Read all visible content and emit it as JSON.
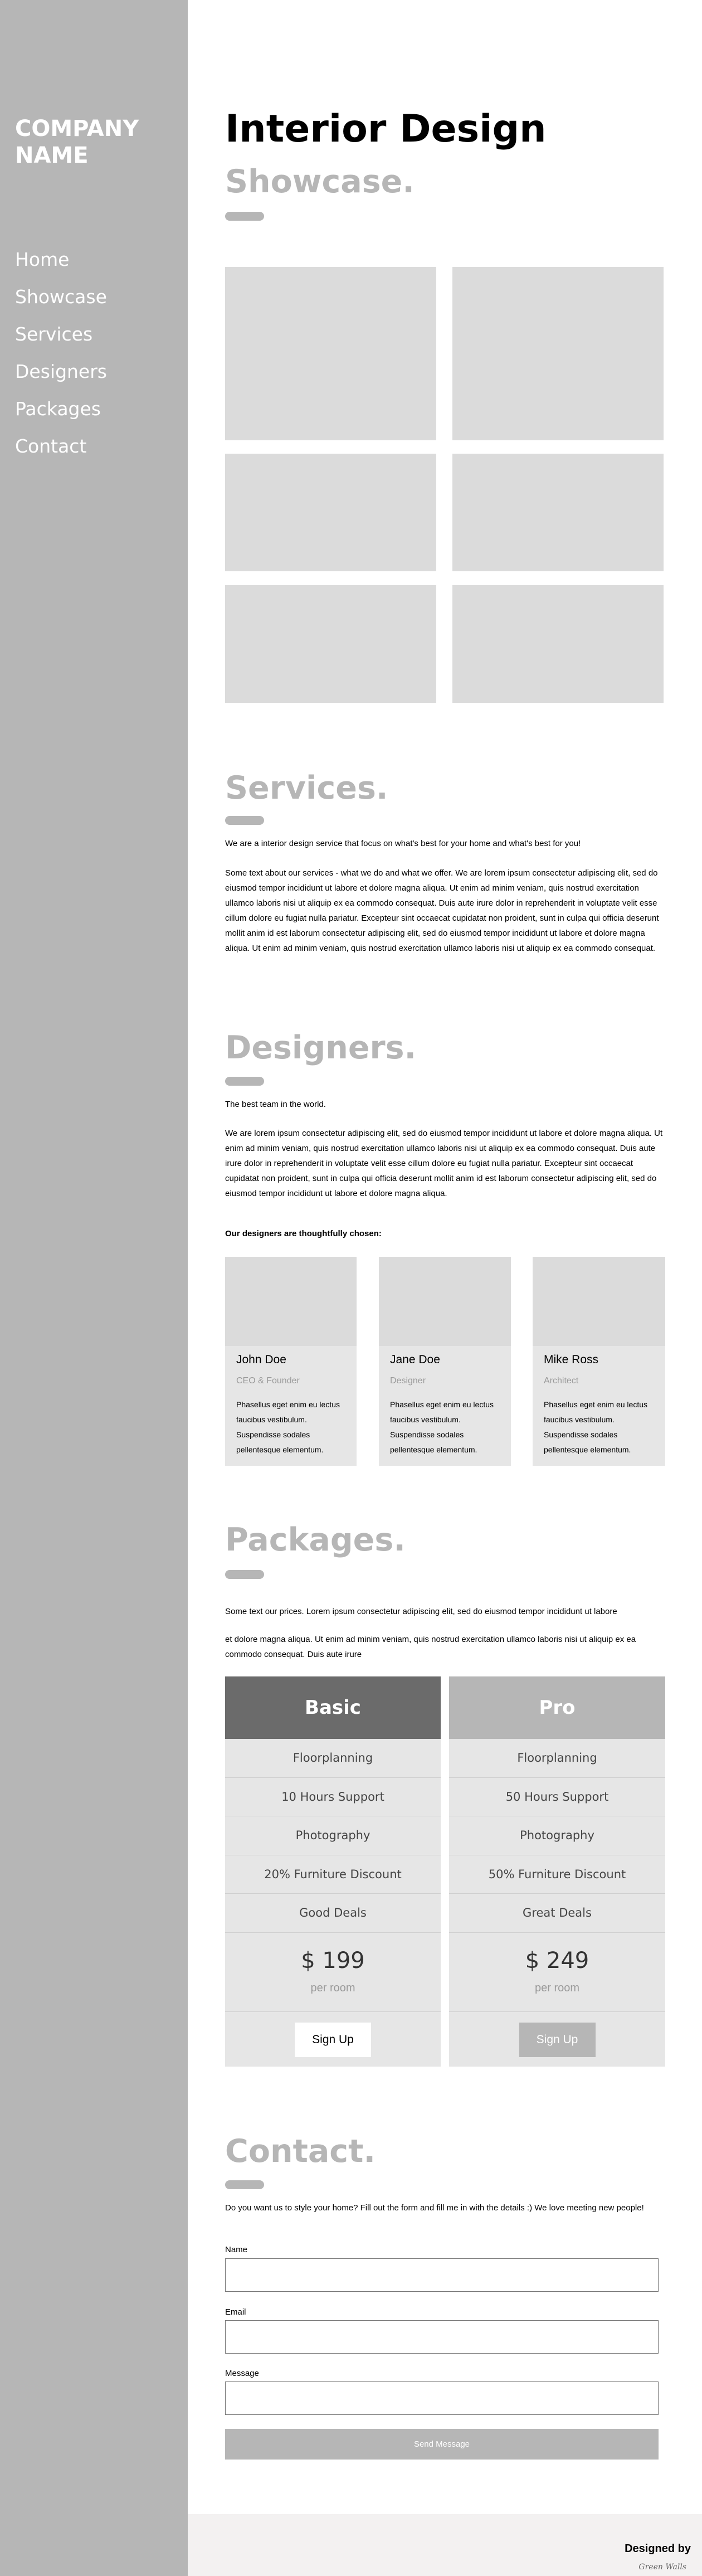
{
  "sidebar": {
    "company": "COMPANY NAME",
    "nav": [
      "Home",
      "Showcase",
      "Services",
      "Designers",
      "Packages",
      "Contact"
    ]
  },
  "hero": {
    "title": "Interior Design",
    "subtitle": "Showcase."
  },
  "services": {
    "heading": "Services.",
    "intro": "We are a interior design service that focus on what's best for your home and what's best for you!",
    "body": "Some text about our services - what we do and what we offer. We are lorem ipsum consectetur adipiscing elit, sed do eiusmod tempor incididunt ut labore et dolore magna aliqua. Ut enim ad minim veniam, quis nostrud exercitation ullamco laboris nisi ut aliquip ex ea commodo consequat. Duis aute irure dolor in reprehenderit in voluptate velit esse cillum dolore eu fugiat nulla pariatur. Excepteur sint occaecat cupidatat non proident, sunt in culpa qui officia deserunt mollit anim id est laborum consectetur adipiscing elit, sed do eiusmod tempor incididunt ut labore et dolore magna aliqua. Ut enim ad minim veniam, quis nostrud exercitation ullamco laboris nisi ut aliquip ex ea commodo consequat."
  },
  "designers": {
    "heading": "Designers.",
    "intro": "The best team in the world.",
    "body": "We are lorem ipsum consectetur adipiscing elit, sed do eiusmod tempor incididunt ut labore et dolore magna aliqua. Ut enim ad minim veniam, quis nostrud exercitation ullamco laboris nisi ut aliquip ex ea commodo consequat. Duis aute irure dolor in reprehenderit in voluptate velit esse cillum dolore eu fugiat nulla pariatur. Excepteur sint occaecat cupidatat non proident, sunt in culpa qui officia deserunt mollit anim id est laborum consectetur adipiscing elit, sed do eiusmod tempor incididunt ut labore et dolore magna aliqua.",
    "chosen": "Our designers are thoughtfully chosen:",
    "people": [
      {
        "name": "John Doe",
        "role": "CEO & Founder",
        "desc": "Phasellus eget enim eu lectus faucibus vestibulum. Suspendisse sodales pellentesque elementum."
      },
      {
        "name": "Jane Doe",
        "role": "Designer",
        "desc": "Phasellus eget enim eu lectus faucibus vestibulum. Suspendisse sodales pellentesque elementum."
      },
      {
        "name": "Mike Ross",
        "role": "Architect",
        "desc": "Phasellus eget enim eu lectus faucibus vestibulum. Suspendisse sodales pellentesque elementum."
      }
    ]
  },
  "packages": {
    "heading": "Packages.",
    "intro": "Some text our prices. Lorem ipsum consectetur adipiscing elit, sed do eiusmod tempor incididunt ut labore",
    "body": "et dolore magna aliqua. Ut enim ad minim veniam, quis nostrud exercitation ullamco laboris nisi ut aliquip ex ea commodo consequat. Duis aute irure",
    "plans": [
      {
        "name": "Basic",
        "head_color": "#6b6b6b",
        "features": [
          "Floorplanning",
          "10 Hours Support",
          "Photography",
          "20% Furniture Discount",
          "Good Deals"
        ],
        "price": "$ 199",
        "per": "per room",
        "button": "Sign Up",
        "btn_bg": "#ffffff",
        "btn_fg": "#000000"
      },
      {
        "name": "Pro",
        "head_color": "#b6b6b6",
        "features": [
          "Floorplanning",
          "50 Hours Support",
          "Photography",
          "50% Furniture Discount",
          "Great Deals"
        ],
        "price": "$ 249",
        "per": "per room",
        "button": "Sign Up",
        "btn_bg": "#b6b6b6",
        "btn_fg": "#ffffff"
      }
    ]
  },
  "contact": {
    "heading": "Contact.",
    "intro": "Do you want us to style your home? Fill out the form and fill me in with the details :) We love meeting new people!",
    "name_label": "Name",
    "email_label": "Email",
    "message_label": "Message",
    "send": "Send Message"
  },
  "footer": {
    "designed_by": "Designed by",
    "signature": "Green Walls"
  }
}
